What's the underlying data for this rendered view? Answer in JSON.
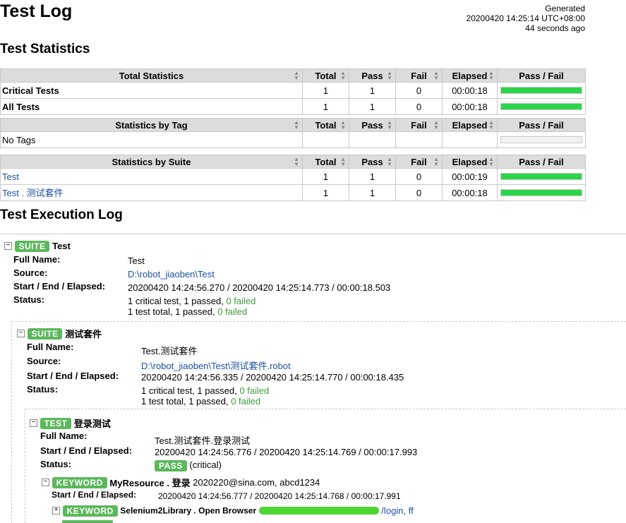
{
  "header": {
    "title": "Test Log",
    "generated_label": "Generated",
    "generated_time": "20200420 14:25:14 UTC+08:00",
    "generated_ago": "44 seconds ago"
  },
  "sections": {
    "statistics": "Test Statistics",
    "execution": "Test Execution Log"
  },
  "columns": {
    "total": "Total",
    "pass": "Pass",
    "fail": "Fail",
    "elapsed": "Elapsed",
    "passfail": "Pass / Fail"
  },
  "total_stats": {
    "header": "Total Statistics",
    "rows": [
      {
        "name": "Critical Tests",
        "total": "1",
        "pass": "1",
        "fail": "0",
        "elapsed": "00:00:18",
        "pass_ratio": 1.0
      },
      {
        "name": "All Tests",
        "total": "1",
        "pass": "1",
        "fail": "0",
        "elapsed": "00:00:18",
        "pass_ratio": 1.0
      }
    ]
  },
  "tag_stats": {
    "header": "Statistics by Tag",
    "rows": [
      {
        "name": "No Tags"
      }
    ]
  },
  "suite_stats": {
    "header": "Statistics by Suite",
    "rows": [
      {
        "name": "Test",
        "total": "1",
        "pass": "1",
        "fail": "0",
        "elapsed": "00:00:19",
        "pass_ratio": 1.0
      },
      {
        "name": "Test . 测试套件",
        "total": "1",
        "pass": "1",
        "fail": "0",
        "elapsed": "00:00:18",
        "pass_ratio": 1.0
      }
    ]
  },
  "labels": {
    "full_name": "Full Name:",
    "source": "Source:",
    "start_end": "Start / End / Elapsed:",
    "status": "Status:"
  },
  "suite1": {
    "badge": "SUITE",
    "name": "Test",
    "full_name": "Test",
    "source": "D:\\robot_jiaoben\\Test",
    "times": "20200420 14:24:56.270 / 20200420 14:25:14.773 / 00:00:18.503",
    "status_line1_a": "1 critical test, 1 passed, ",
    "status_line1_b": "0 failed",
    "status_line2_a": "1 test total, 1 passed, ",
    "status_line2_b": "0 failed"
  },
  "suite2": {
    "badge": "SUITE",
    "name": "测试套件",
    "full_name": "Test.测试套件",
    "source": "D:\\robot_jiaoben\\Test\\测试套件.robot",
    "times": "20200420 14:24:56.335 / 20200420 14:25:14.770 / 00:00:18.435",
    "status_line1_a": "1 critical test, 1 passed, ",
    "status_line1_b": "0 failed",
    "status_line2_a": "1 test total, 1 passed, ",
    "status_line2_b": "0 failed"
  },
  "test1": {
    "badge": "TEST",
    "name": "登录测试",
    "full_name": "Test.测试套件.登录测试",
    "times": "20200420 14:24:56.776 / 20200420 14:25:14.769 / 00:00:17.993",
    "status_badge": "PASS",
    "status_note": "(critical)"
  },
  "keyword1": {
    "badge": "KEYWORD",
    "name": "MyResource . 登录",
    "args": "2020220@sina.com, abcd1234",
    "times": "20200420 14:24:56.777 / 20200420 14:25:14.768 / 00:00:17.991"
  },
  "keyword2": {
    "badge": "KEYWORD",
    "name": "Selenium2Library . Open Browser",
    "args_visible": "/login, ff"
  },
  "colors": {
    "badge_green": "#5cb85c",
    "bar_green": "#2ad549",
    "link_blue": "#1a51a3",
    "header_gray": "#dcdcdc"
  }
}
